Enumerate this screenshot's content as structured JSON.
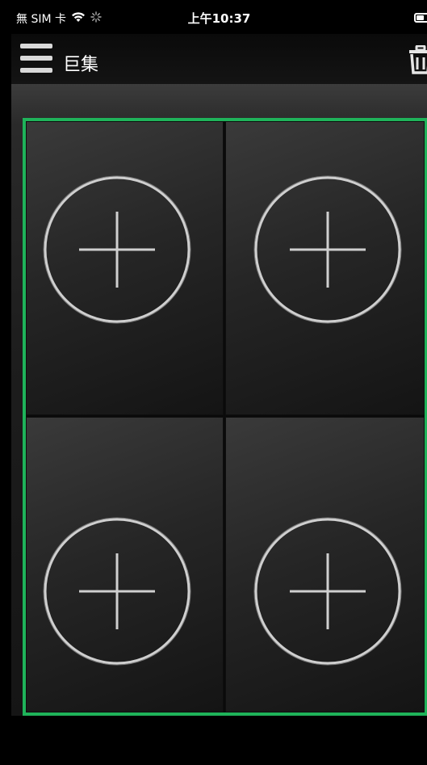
{
  "status_bar": {
    "carrier": "無 SIM 卡",
    "wifi_icon": "wifi-icon",
    "activity_icon": "spinner-icon",
    "time": "上午10:37",
    "battery_icon": "battery-icon"
  },
  "nav": {
    "menu_icon": "hamburger-menu-icon",
    "title": "巨集",
    "delete_icon": "trash-icon"
  },
  "grid": {
    "accent_color": "#1fb35a",
    "slots": [
      {
        "position": "top-left",
        "icon": "add-circle-icon"
      },
      {
        "position": "top-right",
        "icon": "add-circle-icon"
      },
      {
        "position": "bottom-left",
        "icon": "add-circle-icon"
      },
      {
        "position": "bottom-right",
        "icon": "add-circle-icon"
      }
    ]
  }
}
